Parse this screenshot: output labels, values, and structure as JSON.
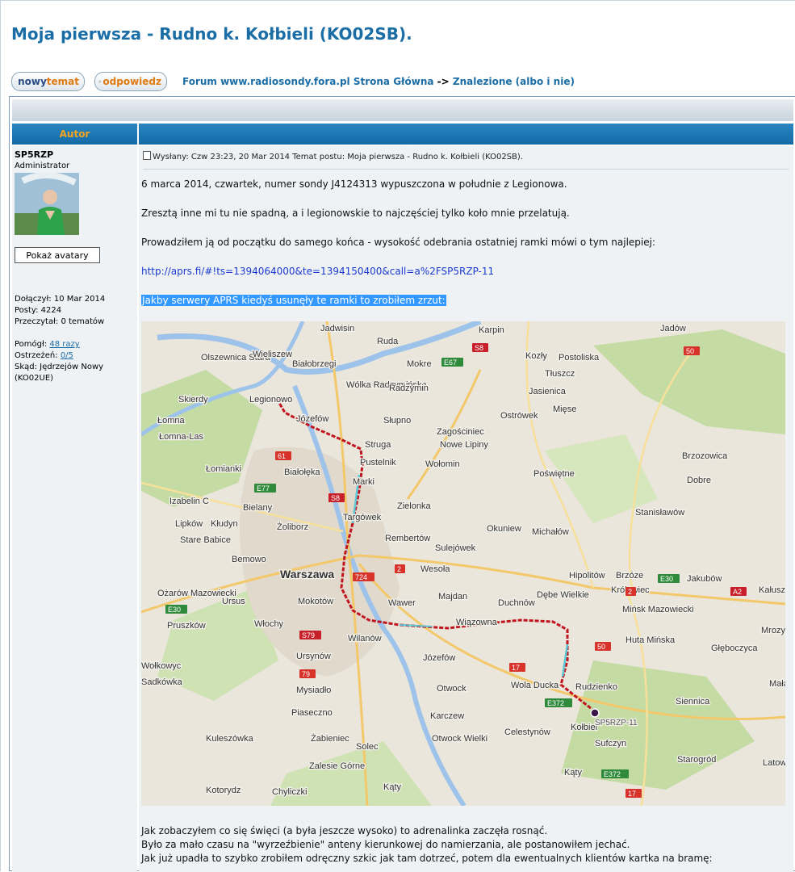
{
  "topic": {
    "title": "Moja pierwsza - Rudno k. Kołbieli (KO02SB)."
  },
  "buttons": {
    "new_topic": {
      "w1": "nowy",
      "w2": "temat"
    },
    "reply": {
      "w1": "odpowiedz"
    }
  },
  "breadcrumb": {
    "forum": "Forum www.radiosondy.fora.pl Strona Główna",
    "separator": "->",
    "section": "Znalezione (albo i nie)"
  },
  "table_header": {
    "author": "Autor"
  },
  "author": {
    "name": "SP5RZP",
    "rank": "Administrator",
    "show_avatars": "Pokaż avatary",
    "joined": "Dołączył: 10 Mar 2014",
    "posts": "Posty: 4224",
    "read": "Przeczytał: 0 tematów",
    "helped_label": "Pomógł:",
    "helped_link": "48 razy",
    "warnings_label": "Ostrzeżeń:",
    "warnings_link": "0/5",
    "from1": "Skąd: Jędrzejów Nowy",
    "from2": "(KO02UE)"
  },
  "post": {
    "meta": "Wysłany: Czw 23:23, 20 Mar 2014    Temat postu: Moja pierwsza - Rudno k. Kołbieli (KO02SB).",
    "line1": "6 marca 2014, czwartek, numer sondy J4124313 wypuszczona w południe z Legionowa.",
    "line2": "Zresztą inne mi tu nie spadną, a i legionowskie to najczęściej tylko koło mnie przelatują.",
    "line3": "Prowadziłem ją od początku do samego końca - wysokość odebrania ostatniej ramki mówi o tym najlepiej:",
    "link": "http://aprs.fi/#!ts=1394064000&te=1394150400&call=a%2FSP5RZP-11",
    "highlight": "Jakby serwery APRS kiedyś usunęły te ramki to zrobiłem zrzut:",
    "after1": "Jak zobaczyłem co się święci (a była jeszcze wysoko) to adrenalinka zaczęła rosnąć.",
    "after2": "Było za mało czasu na \"wyrzeźbienie\" anteny kierunkowej do namierzania, ale postanowiłem jechać.",
    "after3": "Jak już upadła to szybko zrobiłem odręczny szkic jak tam dotrzeć, potem dla ewentualnych klientów kartka na bramę:"
  },
  "map": {
    "places": [
      "Jadwisin",
      "Karpin",
      "Jadów",
      "Ruda",
      "Olszewnica Stara",
      "Wieliszew",
      "Białobrzegi",
      "Mokre",
      "Kozły",
      "Postoliska",
      "Wólka Radzymińska",
      "Radzymin",
      "Tłuszcz",
      "Jasienica",
      "Skierdy",
      "Legionowo",
      "Józefów",
      "Słupno",
      "Mięse",
      "Ostrówek",
      "Łomna",
      "Łomna-Las",
      "Struga",
      "Zagościniec",
      "Nowe Lipiny",
      "Pustelnik",
      "Wołomin",
      "Poświętne",
      "Brzozowica",
      "Łomianki",
      "Białołęka",
      "Marki",
      "Dobre",
      "Izabelin C",
      "Bielany",
      "Zielonka",
      "Stanisławów",
      "Lipków",
      "Kłudyn",
      "Targówek",
      "Okuniew",
      "Michałów",
      "Stare Babice",
      "Żoliborz",
      "Rembertów",
      "Sulejówek",
      "Bemowo",
      "Warszawa",
      "Wesoła",
      "Hipolitów",
      "Brzóze",
      "Ożarów Mazowiecki",
      "Mokotów",
      "Wawer",
      "Majdan",
      "Dębe Wielkie",
      "Królewiec",
      "Jakubów",
      "Kałusz",
      "Ursus",
      "Duchnów",
      "Mińsk Mazowiecki",
      "Pruszków",
      "Włochy",
      "Wiązowna",
      "Mrozy",
      "Wilanów",
      "Huta Mińska",
      "Ursynów",
      "Józefów",
      "Głęboczyca",
      "Mysiadło",
      "Otwock",
      "Wola Ducka",
      "Rudzienko",
      "Siennica",
      "Mała",
      "Piaseczno",
      "Karczew",
      "Kołbiel",
      "Kuleszówka",
      "Żabieniec",
      "Otwock Wielki",
      "Celestynów",
      "Sufczyn",
      "Starogród",
      "Latowi",
      "Solec",
      "Zalesie Górne",
      "Kąty",
      "Kąty",
      "Kotorydz",
      "Chyliczki",
      "Wołkowyc",
      "Sadkówka",
      "SP5RZP-11"
    ],
    "roads": [
      "61",
      "S8",
      "E67",
      "50",
      "E77",
      "S8",
      "2",
      "724",
      "E30",
      "A2",
      "2",
      "17",
      "E372",
      "E30",
      "S79",
      "79",
      "50",
      "17",
      "E372"
    ]
  }
}
